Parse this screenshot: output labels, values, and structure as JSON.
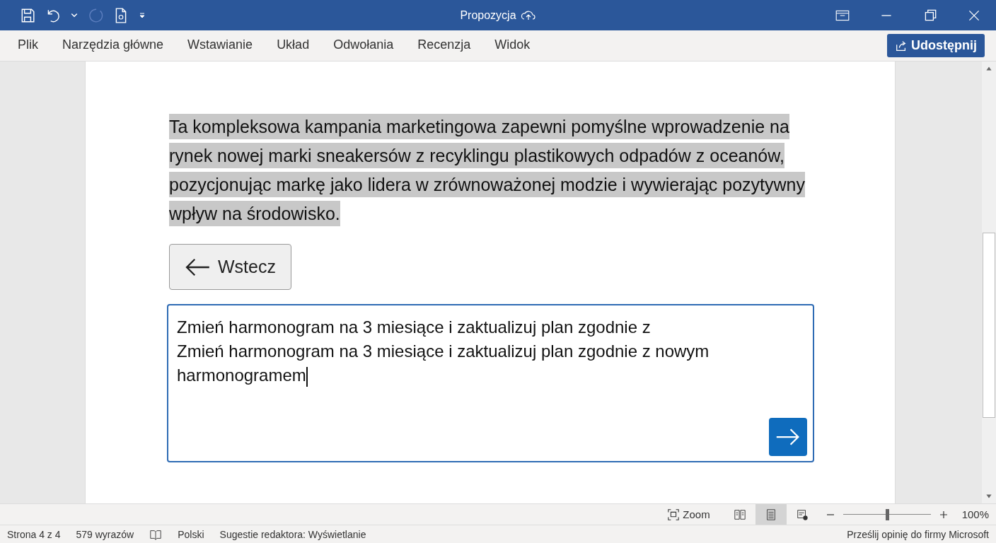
{
  "window": {
    "title": "Propozycja"
  },
  "ribbon": {
    "tabs": [
      {
        "label": "Plik",
        "selected": false
      },
      {
        "label": "Narzędzia główne",
        "selected": false
      },
      {
        "label": "Wstawianie",
        "selected": false
      },
      {
        "label": "Układ",
        "selected": false
      },
      {
        "label": "Odwołania",
        "selected": false
      },
      {
        "label": "Recenzja",
        "selected": false
      },
      {
        "label": "Widok",
        "selected": false
      }
    ],
    "share_button": "Udostępnij"
  },
  "document": {
    "paragraph": "Ta kompleksowa kampania marketingowa zapewni pomyślne wprowadzenie na rynek nowej marki sneakersów z recyklingu plastikowych odpadów z oceanów, pozycjonując markę jako lidera w zrównoważonej modzie i wywierając pozytywny wpływ na środowisko.",
    "back_button": "Wstecz",
    "prompt": {
      "value": "Zmień harmonogram na 3 miesiące i zaktualizuj plan zgodnie z\nZmień harmonogram na 3 miesiące i zaktualizuj plan zgodnie z nowym harmonogramem"
    }
  },
  "view_bar": {
    "focus": "Zoom",
    "views": [
      {
        "kind": "read",
        "selected": false
      },
      {
        "kind": "print",
        "selected": true
      },
      {
        "kind": "web",
        "selected": false
      }
    ],
    "zoom": {
      "level": 0.5,
      "reading": "100%"
    }
  },
  "status_bar": {
    "page": "Strona 4 z 4",
    "words": "579 wyrazów",
    "language": "Polski",
    "editor": "Sugestie redaktora: Wyświetlanie",
    "feedback": "Prześlij opinię do firmy Microsoft"
  }
}
